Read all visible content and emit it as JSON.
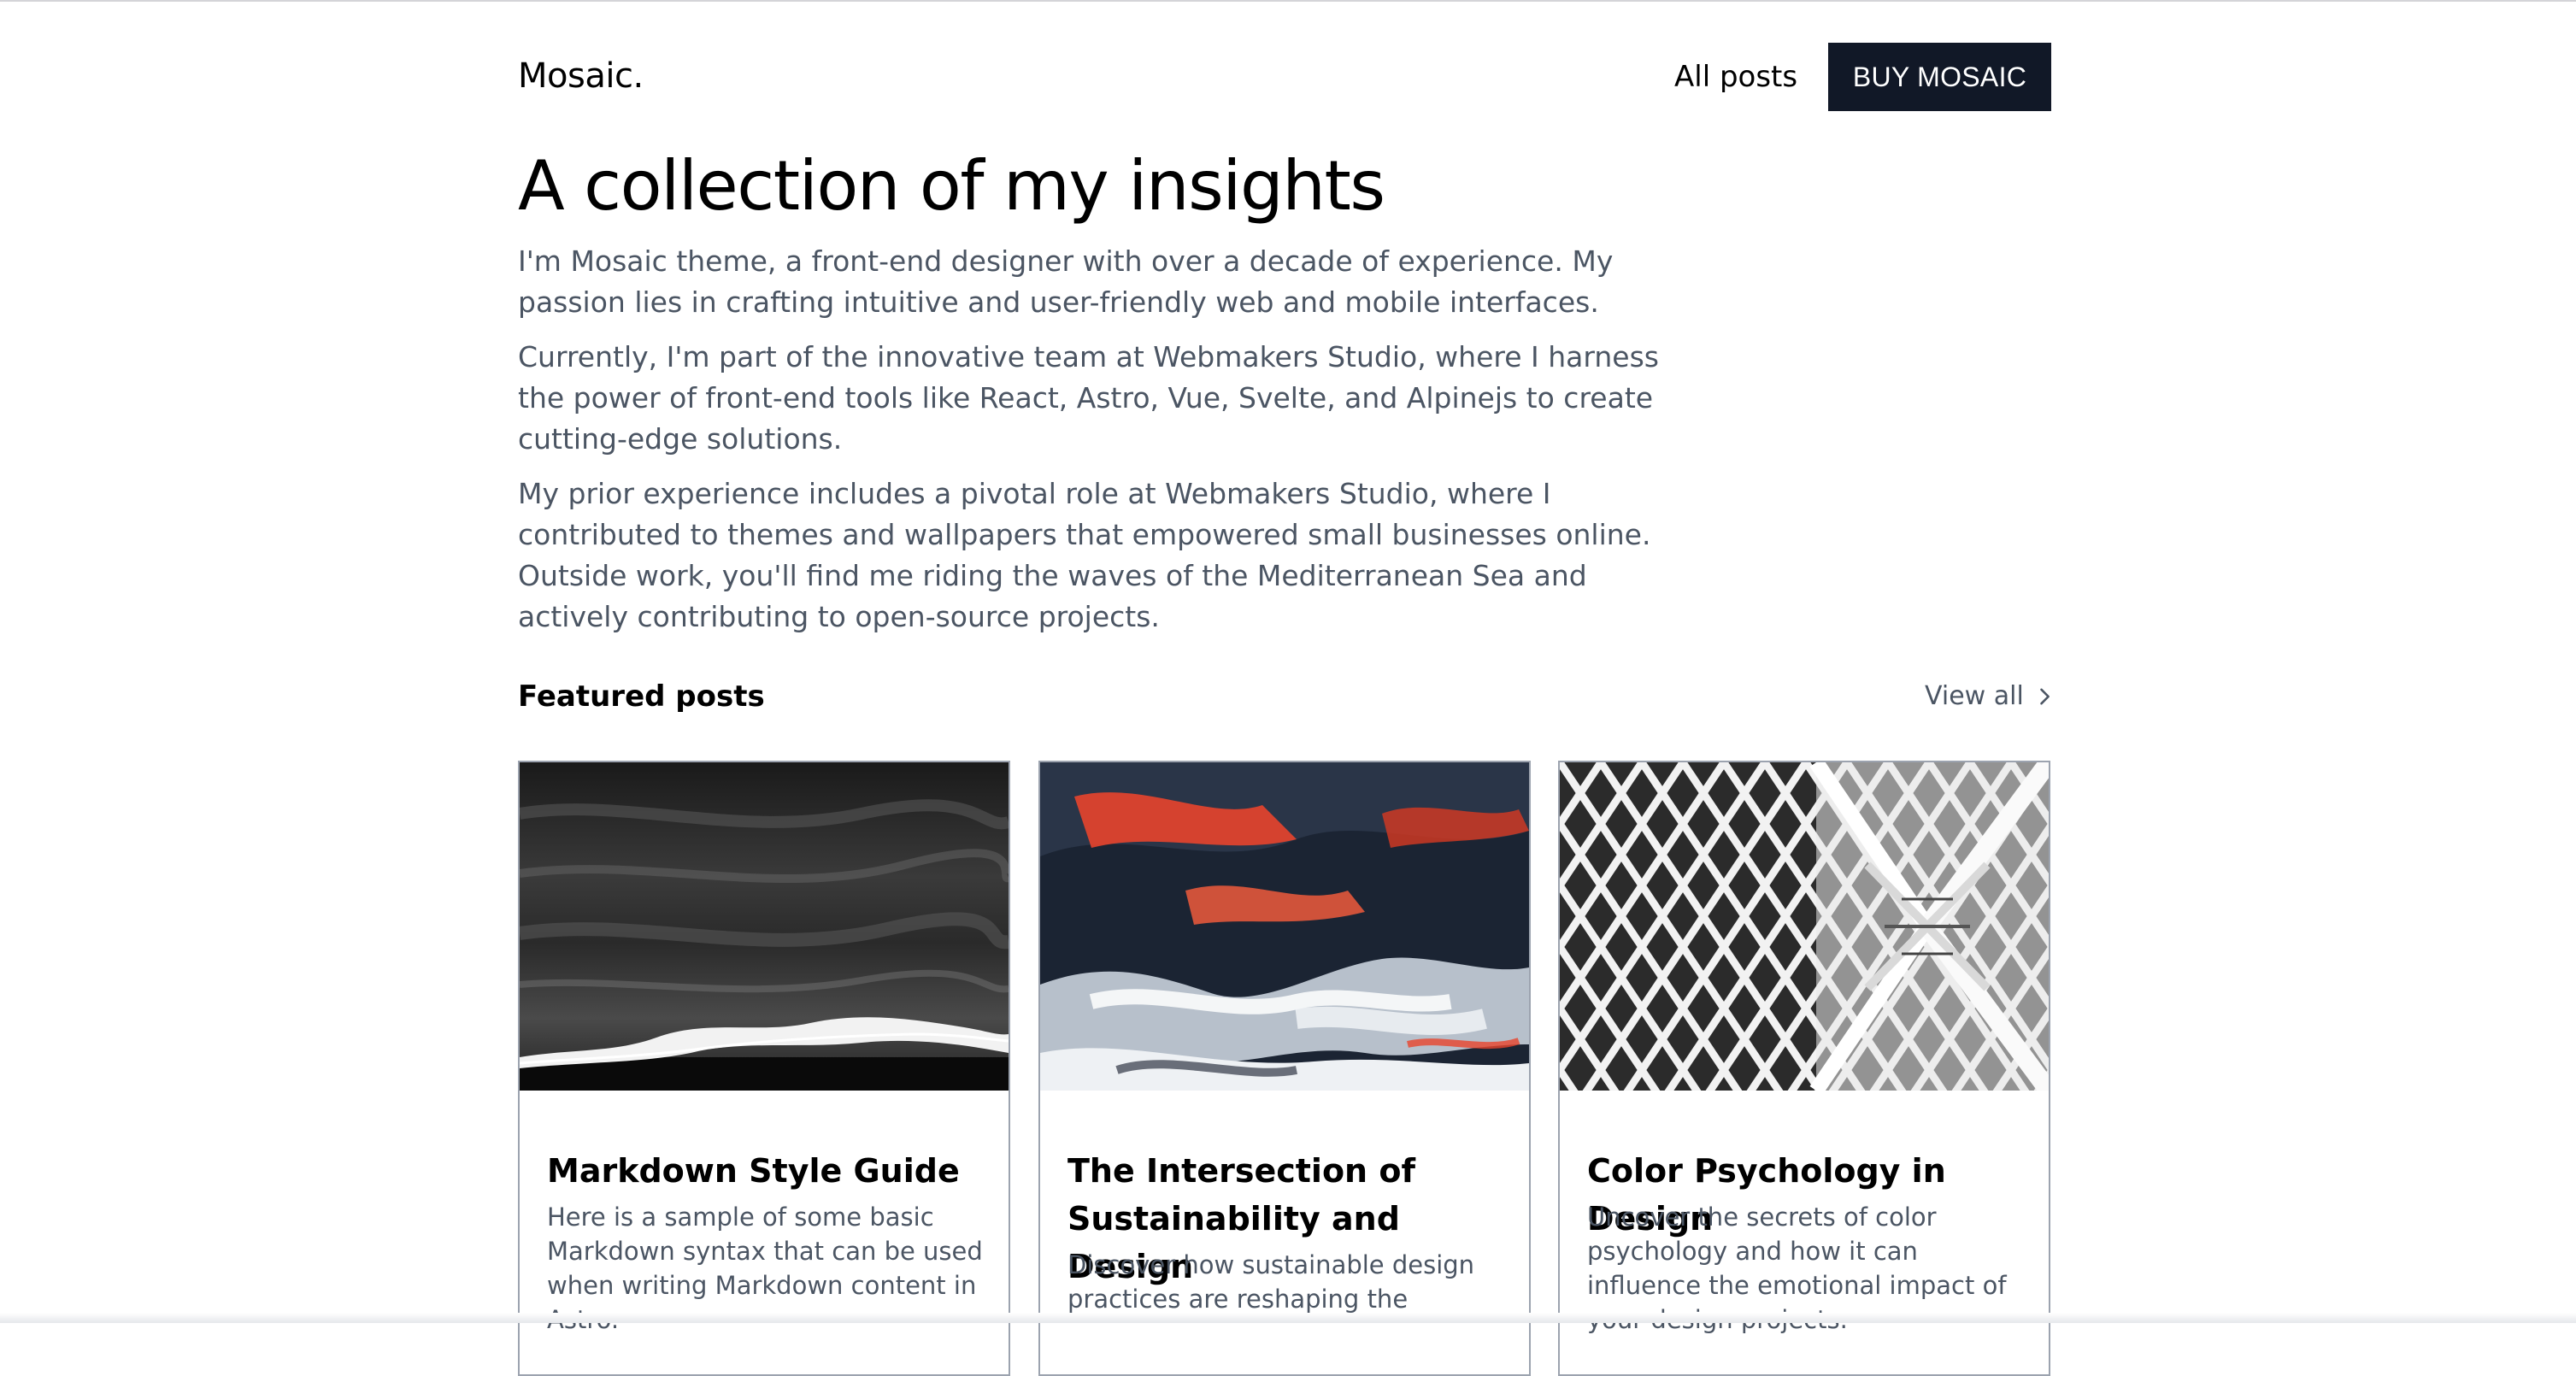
{
  "header": {
    "logo": "Mosaic.",
    "nav_all_posts": "All posts",
    "buy_button": "BUY MOSAIC"
  },
  "hero": {
    "title": "A collection of my insights",
    "paragraphs": [
      "I'm Mosaic theme, a front-end designer with over a decade of experience. My passion lies in crafting intuitive and user-friendly web and mobile interfaces.",
      "Currently, I'm part of the innovative team at Webmakers Studio, where I harness the power of front-end tools like React, Astro, Vue, Svelte, and Alpinejs to create cutting-edge solutions.",
      "My prior experience includes a pivotal role at Webmakers Studio, where I contributed to themes and wallpapers that empowered small businesses online. Outside work, you'll find me riding the waves of the Mediterranean Sea and actively contributing to open-source projects."
    ]
  },
  "featured": {
    "title": "Featured posts",
    "view_all": "View all",
    "view_all_icon": "chevron-right-icon",
    "posts": [
      {
        "title": "Markdown Style Guide",
        "excerpt": "Here is a sample of some basic Markdown syntax that can be used when writing Markdown content in Astro."
      },
      {
        "title": "The Intersection of Sustainability and Design",
        "excerpt": "Discover how sustainable design practices are reshaping the"
      },
      {
        "title": "Color Psychology in Design",
        "excerpt": "Uncover the secrets of color psychology and how it can influence the emotional impact of your design projects."
      }
    ]
  },
  "colors": {
    "button_bg": "#111827",
    "body_text": "#4b5563",
    "card_border": "#9ca3af",
    "accent_red": "#e8442c"
  }
}
